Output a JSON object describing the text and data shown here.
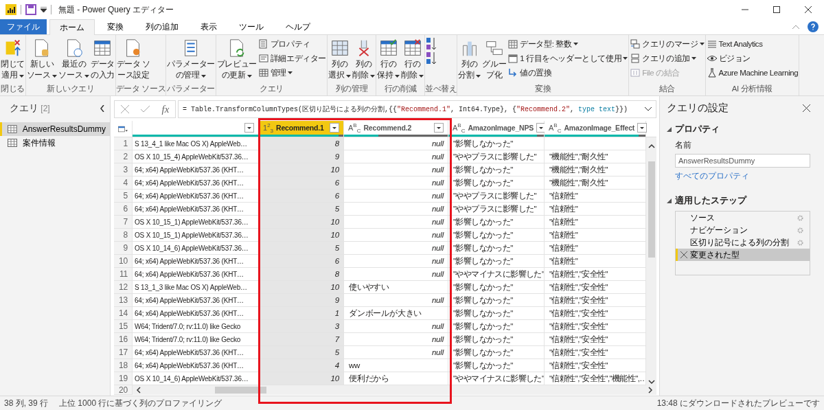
{
  "title_bar": {
    "title": "無題 - Power Query エディター"
  },
  "menu_tabs": [
    {
      "label": "ファイル",
      "kind": "file",
      "selected": false
    },
    {
      "label": "ホーム",
      "kind": "tab",
      "selected": true
    },
    {
      "label": "変換",
      "kind": "tab",
      "selected": false
    },
    {
      "label": "列の追加",
      "kind": "tab",
      "selected": false
    },
    {
      "label": "表示",
      "kind": "tab",
      "selected": false
    },
    {
      "label": "ツール",
      "kind": "tab",
      "selected": false
    },
    {
      "label": "ヘルプ",
      "kind": "tab",
      "selected": false
    }
  ],
  "ribbon_groups": [
    {
      "label": "閉じる",
      "items": [
        {
          "kind": "large",
          "lines": [
            "閉じて",
            "適用"
          ],
          "dropdown": true
        }
      ]
    },
    {
      "label": "新しいクエリ",
      "items": [
        {
          "kind": "large",
          "lines": [
            "新しい",
            "ソース"
          ],
          "dropdown": true
        },
        {
          "kind": "large",
          "lines": [
            "最近の",
            "ソース"
          ],
          "dropdown": true
        },
        {
          "kind": "large",
          "lines": [
            "データ",
            "の入力"
          ],
          "dropdown": false
        }
      ]
    },
    {
      "label": "データ ソース",
      "items": [
        {
          "kind": "large",
          "lines": [
            "データ ソ",
            "ース設定"
          ],
          "dropdown": false
        }
      ]
    },
    {
      "label": "パラメーター",
      "items": [
        {
          "kind": "large",
          "lines": [
            "パラメーター",
            "の管理"
          ],
          "dropdown": true
        }
      ]
    },
    {
      "label": "クエリ",
      "items": [
        {
          "kind": "large",
          "lines": [
            "プレビュー",
            "の更新"
          ],
          "dropdown": true
        },
        {
          "kind": "small",
          "label": "プロパティ",
          "dropdown": false,
          "disabled": false
        },
        {
          "kind": "small",
          "label": "詳細エディター",
          "dropdown": false,
          "disabled": false
        },
        {
          "kind": "small",
          "label": "管理",
          "dropdown": true,
          "disabled": false
        }
      ]
    },
    {
      "label": "列の管理",
      "items": [
        {
          "kind": "large",
          "lines": [
            "列の",
            "選択"
          ],
          "dropdown": true
        },
        {
          "kind": "large",
          "lines": [
            "列の",
            "削除"
          ],
          "dropdown": true
        }
      ]
    },
    {
      "label": "行の削減",
      "items": [
        {
          "kind": "large",
          "lines": [
            "行の",
            "保持"
          ],
          "dropdown": true
        },
        {
          "kind": "large",
          "lines": [
            "行の",
            "削除"
          ],
          "dropdown": true
        }
      ]
    },
    {
      "label": "並べ替え",
      "items": [
        {
          "kind": "icon"
        },
        {
          "kind": "icon"
        }
      ]
    },
    {
      "label": "変換",
      "items": [
        {
          "kind": "large",
          "lines": [
            "列の",
            "分割"
          ],
          "dropdown": true
        },
        {
          "kind": "large",
          "lines": [
            "グルー",
            "プ化"
          ],
          "dropdown": false
        },
        {
          "kind": "small",
          "label": "データ型: 整数",
          "dropdown": true,
          "disabled": false
        },
        {
          "kind": "small",
          "label": "1 行目をヘッダーとして使用",
          "dropdown": true,
          "disabled": false
        },
        {
          "kind": "small",
          "label": "値の置換",
          "dropdown": false,
          "disabled": false
        }
      ]
    },
    {
      "label": "結合",
      "items": [
        {
          "kind": "small",
          "label": "クエリのマージ",
          "dropdown": true,
          "disabled": false
        },
        {
          "kind": "small",
          "label": "クエリの追加",
          "dropdown": true,
          "disabled": false
        },
        {
          "kind": "small",
          "label": "File の結合",
          "dropdown": false,
          "disabled": true
        }
      ]
    },
    {
      "label": "AI 分析情報",
      "items": [
        {
          "kind": "small",
          "label": "Text Analytics",
          "dropdown": false,
          "disabled": false
        },
        {
          "kind": "small",
          "label": "ビジョン",
          "dropdown": false,
          "disabled": false
        },
        {
          "kind": "small",
          "label": "Azure Machine Learning",
          "dropdown": false,
          "disabled": false
        }
      ]
    }
  ],
  "queries_panel": {
    "title": "クエリ",
    "count": "[2]",
    "items": [
      {
        "label": "AnswerResultsDummy",
        "selected": true
      },
      {
        "label": "案件情報",
        "selected": false
      }
    ]
  },
  "formula_bar": {
    "fx_label": "fx",
    "segments": [
      {
        "kind": "plain",
        "text": "= Table.TransformColumnTypes(区切り記号による列の分割,{{"
      },
      {
        "kind": "string",
        "text": "\"Recommend.1\""
      },
      {
        "kind": "plain",
        "text": ", Int64.Type}, {"
      },
      {
        "kind": "string",
        "text": "\"Recommend.2\""
      },
      {
        "kind": "plain",
        "text": ", "
      },
      {
        "kind": "keyword",
        "text": "type text"
      },
      {
        "kind": "plain",
        "text": "}})"
      }
    ]
  },
  "table": {
    "columns": [
      {
        "selected": false,
        "level": 1
      },
      {
        "label": "Recommend.1",
        "type_label": "1$^{2}$$_{3}$",
        "selected": true,
        "level": 0.94
      },
      {
        "label": "Recommend.2",
        "type_label": "A$^{B}$$_{C}$",
        "selected": false,
        "level": 0.33
      },
      {
        "label": "AmazonImage_NPS",
        "type_label": "A$^{B}$$_{C}$",
        "selected": false,
        "level": 0.93
      },
      {
        "label": "AmazonImage_Effect",
        "type_label": "A$^{B}$$_{C}$",
        "selected": false,
        "level": 0.93
      }
    ],
    "rows": [
      {
        "number": "1",
        "column_1": "S 13_4_1 like Mac OS X) AppleWeb…",
        "recommend_1": "8",
        "recommend_2": "null",
        "recommend_2_null": true,
        "nps": "\"影響しなかった\""
      },
      {
        "number": "2",
        "column_1": "OS X 10_15_4) AppleWebKit/537.36…",
        "recommend_1": "9",
        "recommend_2": "null",
        "recommend_2_null": true,
        "nps": "\"ややプラスに影響した\"",
        "effect": "\"機能性\",\"耐久性\""
      },
      {
        "number": "3",
        "column_1": "64; x64) AppleWebKit/537.36 (KHT…",
        "recommend_1": "10",
        "recommend_2": "null",
        "recommend_2_null": true,
        "nps": "\"影響しなかった\"",
        "effect": "\"機能性\",\"耐久性\""
      },
      {
        "number": "4",
        "column_1": "64; x64) AppleWebKit/537.36 (KHT…",
        "recommend_1": "6",
        "recommend_2": "null",
        "recommend_2_null": true,
        "nps": "\"影響しなかった\"",
        "effect": "\"機能性\",\"耐久性\""
      },
      {
        "number": "5",
        "column_1": "64; x64) AppleWebKit/537.36 (KHT…",
        "recommend_1": "6",
        "recommend_2": "null",
        "recommend_2_null": true,
        "nps": "\"ややプラスに影響した\"",
        "effect": "\"信頼性\""
      },
      {
        "number": "6",
        "column_1": "64; x64) AppleWebKit/537.36 (KHT…",
        "recommend_1": "5",
        "recommend_2": "null",
        "recommend_2_null": true,
        "nps": "\"ややプラスに影響した\"",
        "effect": "\"信頼性\""
      },
      {
        "number": "7",
        "column_1": "OS X 10_15_1) AppleWebKit/537.36…",
        "recommend_1": "10",
        "recommend_2": "null",
        "recommend_2_null": true,
        "nps": "\"影響しなかった\"",
        "effect": "\"信頼性\""
      },
      {
        "number": "8",
        "column_1": "OS X 10_15_1) AppleWebKit/537.36…",
        "recommend_1": "10",
        "recommend_2": "null",
        "recommend_2_null": true,
        "nps": "\"影響しなかった\"",
        "effect": "\"信頼性\""
      },
      {
        "number": "9",
        "column_1": "OS X 10_14_6) AppleWebKit/537.36…",
        "recommend_1": "5",
        "recommend_2": "null",
        "recommend_2_null": true,
        "nps": "\"影響しなかった\"",
        "effect": "\"信頼性\""
      },
      {
        "number": "10",
        "column_1": "64; x64) AppleWebKit/537.36 (KHT…",
        "recommend_1": "6",
        "recommend_2": "null",
        "recommend_2_null": true,
        "nps": "\"影響しなかった\"",
        "effect": "\"信頼性\""
      },
      {
        "number": "11",
        "column_1": "64; x64) AppleWebKit/537.36 (KHT…",
        "recommend_1": "8",
        "recommend_2": "null",
        "recommend_2_null": true,
        "nps": "\"ややマイナスに影響した\"",
        "effect": "\"信頼性\",\"安全性\""
      },
      {
        "number": "12",
        "column_1": "S 13_1_3 like Mac OS X) AppleWeb…",
        "recommend_1": "10",
        "recommend_2": "使いやすい",
        "recommend_2_null": false,
        "nps": "\"影響しなかった\"",
        "effect": "\"信頼性\",\"安全性\""
      },
      {
        "number": "13",
        "column_1": "64; x64) AppleWebKit/537.36 (KHT…",
        "recommend_1": "9",
        "recommend_2": "null",
        "recommend_2_null": true,
        "nps": "\"影響しなかった\"",
        "effect": "\"信頼性\",\"安全性\""
      },
      {
        "number": "14",
        "column_1": "64; x64) AppleWebKit/537.36 (KHT…",
        "recommend_1": "1",
        "recommend_2": "ダンボールが大きい",
        "recommend_2_null": false,
        "nps": "\"影響しなかった\"",
        "effect": "\"信頼性\",\"安全性\""
      },
      {
        "number": "15",
        "column_1": "W64; Trident/7.0; rv:11.0) like Gecko",
        "recommend_1": "3",
        "recommend_2": "null",
        "recommend_2_null": true,
        "nps": "\"影響しなかった\"",
        "effect": "\"信頼性\",\"安全性\""
      },
      {
        "number": "16",
        "column_1": "W64; Trident/7.0; rv:11.0) like Gecko",
        "recommend_1": "7",
        "recommend_2": "null",
        "recommend_2_null": true,
        "nps": "\"影響しなかった\"",
        "effect": "\"信頼性\",\"安全性\""
      },
      {
        "number": "17",
        "column_1": "64; x64) AppleWebKit/537.36 (KHT…",
        "recommend_1": "5",
        "recommend_2": "null",
        "recommend_2_null": true,
        "nps": "\"影響しなかった\"",
        "effect": "\"信頼性\",\"安全性\""
      },
      {
        "number": "18",
        "column_1": "64; x64) AppleWebKit/537.36 (KHT…",
        "recommend_1": "4",
        "recommend_2": "ww",
        "recommend_2_null": false,
        "nps": "\"影響しなかった\"",
        "effect": "\"信頼性\",\"安全性\""
      },
      {
        "number": "19",
        "column_1": "OS X 10_14_6) AppleWebKit/537.36…",
        "recommend_1": "10",
        "recommend_2": "便利だから",
        "recommend_2_null": false,
        "nps": "\"ややマイナスに影響した\"",
        "effect": "\"信頼性\",\"安全性\",\"機能性\",…"
      }
    ],
    "partial_row_number": "20"
  },
  "settings_panel": {
    "title": "クエリの設定",
    "properties": {
      "heading": "プロパティ",
      "expanded": true,
      "name_label": "名前",
      "name_value": "AnswerResultsDummy",
      "all_properties_link": "すべてのプロパティ"
    },
    "steps": {
      "heading": "適用したステップ",
      "expanded": true,
      "items": [
        {
          "label": "ソース",
          "has_settings": true,
          "selected": false
        },
        {
          "label": "ナビゲーション",
          "has_settings": true,
          "selected": false
        },
        {
          "label": "区切り記号による列の分割",
          "has_settings": true,
          "selected": false
        },
        {
          "label": "変更された型",
          "has_settings": false,
          "selected": true
        }
      ]
    }
  },
  "status_bar": {
    "counts": "38 列, 39 行",
    "profiling": "上位 1000 行に基づく列のプロファイリング",
    "preview_time": "13:48 にダウンロードされたプレビューです"
  }
}
